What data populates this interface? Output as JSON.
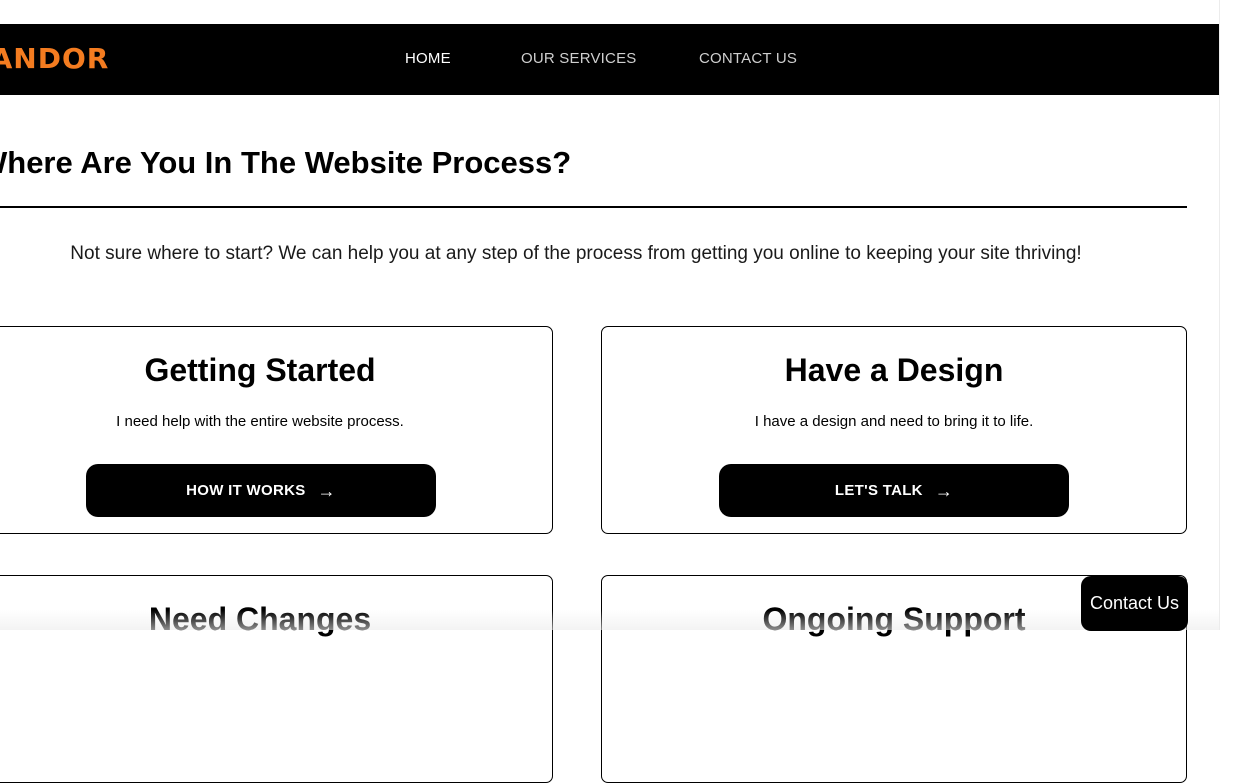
{
  "header": {
    "logo_text": "YANDOR",
    "brand_color": "#f47c20",
    "nav": [
      {
        "label": "HOME",
        "active": true
      },
      {
        "label": "OUR SERVICES",
        "active": false
      },
      {
        "label": "CONTACT US",
        "active": false
      }
    ]
  },
  "main": {
    "title": "Where Are You In The Website Process?",
    "intro": "Not sure where to start? We can help you at any step of the process from getting you online to keeping your site thriving!",
    "cards": [
      {
        "title": "Getting Started",
        "description": "I need help with the entire website process.",
        "button_label": "HOW IT WORKS",
        "button_icon": "arrow-right-icon"
      },
      {
        "title": "Have a Design",
        "description": "I have a design and need to bring it to life.",
        "button_label": "LET'S TALK",
        "button_icon": "arrow-right-icon"
      },
      {
        "title": "Need Changes"
      },
      {
        "title": "Ongoing Support"
      }
    ]
  },
  "floating": {
    "contact_label": "Contact Us"
  }
}
